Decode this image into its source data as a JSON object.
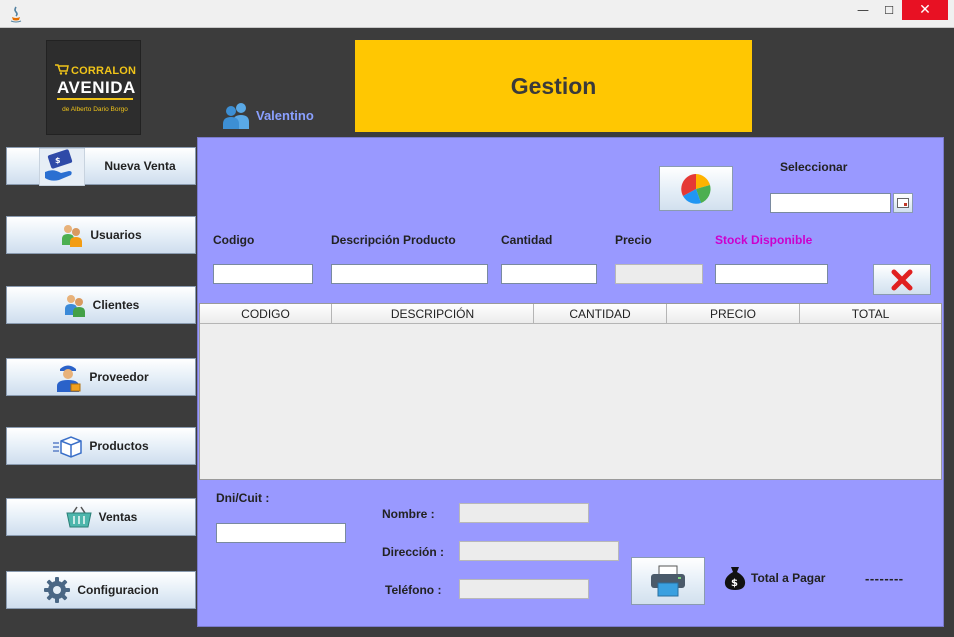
{
  "window": {
    "minimize": "—",
    "maximize": "☐",
    "close": "✕"
  },
  "logo": {
    "line1": "CORRALON",
    "line2": "AVENIDA",
    "line3": "de Alberto Dario Borgo"
  },
  "header": {
    "user_name": "Valentino",
    "title": "Gestion"
  },
  "sidebar": {
    "items": [
      {
        "label": "Nueva Venta",
        "icon": "sale-hand-icon"
      },
      {
        "label": "Usuarios",
        "icon": "users-icon"
      },
      {
        "label": "Clientes",
        "icon": "clients-icon"
      },
      {
        "label": "Proveedor",
        "icon": "supplier-icon"
      },
      {
        "label": "Productos",
        "icon": "box-icon"
      },
      {
        "label": "Ventas",
        "icon": "basket-icon"
      },
      {
        "label": "Configuracion",
        "icon": "gear-icon"
      }
    ]
  },
  "sale_form": {
    "select_label": "Seleccionar",
    "fields": {
      "codigo": {
        "label": "Codigo",
        "value": ""
      },
      "descripcion": {
        "label": "Descripción Producto",
        "value": ""
      },
      "cantidad": {
        "label": "Cantidad",
        "value": ""
      },
      "precio": {
        "label": "Precio",
        "value": ""
      },
      "stock": {
        "label": "Stock Disponible",
        "value": ""
      }
    }
  },
  "table": {
    "columns": [
      "CODIGO",
      "DESCRIPCIÓN",
      "CANTIDAD",
      "PRECIO",
      "TOTAL"
    ],
    "rows": []
  },
  "client": {
    "dni_label": "Dni/Cuit :",
    "dni_value": "",
    "nombre_label": "Nombre :",
    "direccion_label": "Dirección :",
    "telefono_label": "Teléfono :"
  },
  "totals": {
    "label": "Total a Pagar",
    "value": "--------"
  },
  "colors": {
    "banner": "#ffc702",
    "panel": "#9999ff",
    "stock_label": "#cc00cc",
    "user_name": "#8aa0ff"
  }
}
